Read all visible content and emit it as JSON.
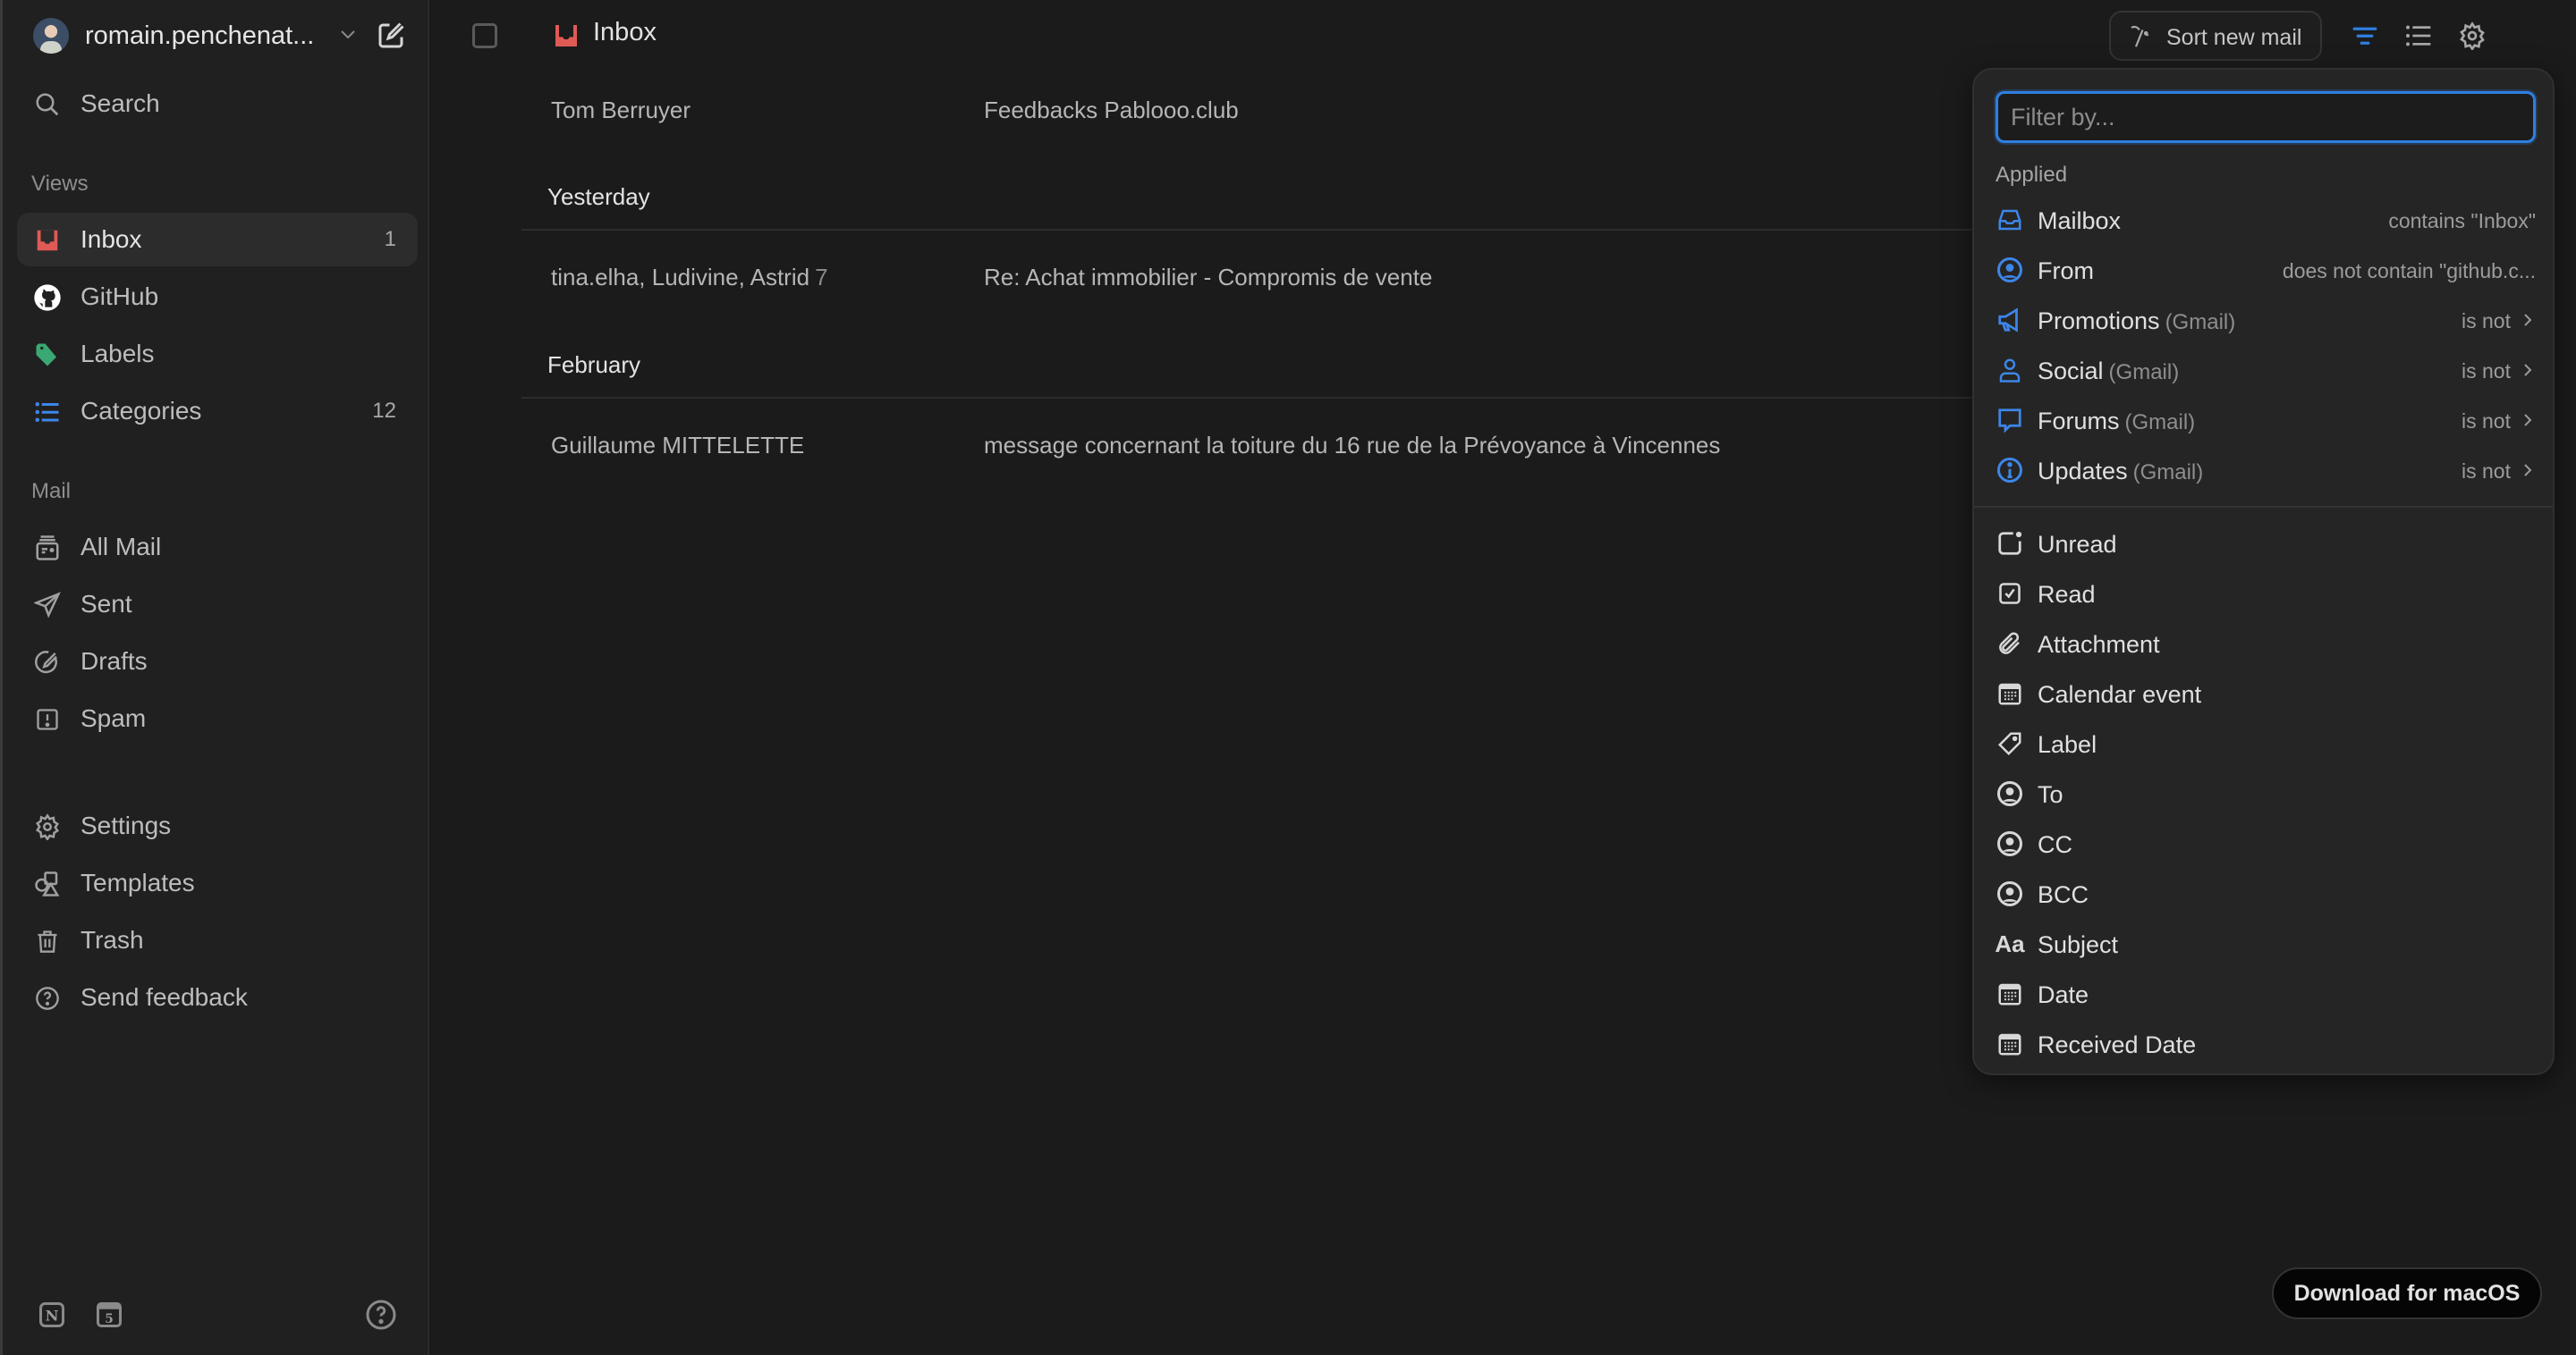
{
  "account": {
    "name": "romain.penchenat..."
  },
  "sidebar": {
    "search_label": "Search",
    "views_label": "Views",
    "views": [
      {
        "label": "Inbox",
        "count": "1",
        "icon": "inbox-icon",
        "active": true
      },
      {
        "label": "GitHub",
        "count": "",
        "icon": "github-icon"
      },
      {
        "label": "Labels",
        "count": "",
        "icon": "tag-icon"
      },
      {
        "label": "Categories",
        "count": "12",
        "icon": "list-icon"
      }
    ],
    "mail_label": "Mail",
    "mail": [
      {
        "label": "All Mail",
        "icon": "archive-icon"
      },
      {
        "label": "Sent",
        "icon": "send-icon"
      },
      {
        "label": "Drafts",
        "icon": "draft-icon"
      },
      {
        "label": "Spam",
        "icon": "spam-icon"
      }
    ],
    "other": [
      {
        "label": "Settings",
        "icon": "gear-icon"
      },
      {
        "label": "Templates",
        "icon": "shapes-icon"
      },
      {
        "label": "Trash",
        "icon": "trash-icon"
      },
      {
        "label": "Send feedback",
        "icon": "help-icon"
      }
    ],
    "bottom": {
      "notion_letter": "N",
      "calendar_day": "5"
    }
  },
  "header": {
    "title": "Inbox",
    "sort_label": "Sort new mail"
  },
  "mail_list": {
    "rows_top": [
      {
        "sender": "Tom Berruyer",
        "count": "",
        "subject": "Feedbacks Pablooo.club"
      }
    ],
    "groups": [
      {
        "label": "Yesterday",
        "rows": [
          {
            "sender": "tina.elha, Ludivine, Astrid",
            "count": "7",
            "subject": "Re: Achat immobilier - Compromis de vente"
          }
        ]
      },
      {
        "label": "February",
        "rows": [
          {
            "sender": "Guillaume MITTELETTE",
            "count": "",
            "subject": "message concernant la toiture du 16 rue de la Prévoyance à Vincennes"
          }
        ]
      }
    ]
  },
  "filter_popup": {
    "placeholder": "Filter by...",
    "value": "",
    "applied_label": "Applied",
    "applied": [
      {
        "label": "Mailbox",
        "sub": "",
        "value": "contains \"Inbox\"",
        "icon": "mailbox-icon",
        "chevron": false
      },
      {
        "label": "From",
        "sub": "",
        "value": "does not contain \"github.c...",
        "icon": "user-circle-icon",
        "chevron": false
      },
      {
        "label": "Promotions",
        "sub": "(Gmail)",
        "value": "is not",
        "icon": "megaphone-icon",
        "chevron": true
      },
      {
        "label": "Social",
        "sub": "(Gmail)",
        "value": "is not",
        "icon": "person-icon",
        "chevron": true
      },
      {
        "label": "Forums",
        "sub": "(Gmail)",
        "value": "is not",
        "icon": "chat-bubble-icon",
        "chevron": true
      },
      {
        "label": "Updates",
        "sub": "(Gmail)",
        "value": "is not",
        "icon": "info-icon",
        "chevron": true
      }
    ],
    "options": [
      {
        "label": "Unread",
        "icon": "unread-icon"
      },
      {
        "label": "Read",
        "icon": "checkbox-checked-icon"
      },
      {
        "label": "Attachment",
        "icon": "paperclip-icon"
      },
      {
        "label": "Calendar event",
        "icon": "calendar-icon"
      },
      {
        "label": "Label",
        "icon": "tag-outline-icon"
      },
      {
        "label": "To",
        "icon": "user-circle-icon"
      },
      {
        "label": "CC",
        "icon": "user-circle-icon"
      },
      {
        "label": "BCC",
        "icon": "user-circle-icon"
      },
      {
        "label": "Subject",
        "icon": "text-icon"
      },
      {
        "label": "Date",
        "icon": "calendar-icon"
      },
      {
        "label": "Received Date",
        "icon": "calendar-icon"
      }
    ]
  },
  "download_label": "Download for macOS",
  "colors": {
    "accent": "#2f7fe0",
    "inbox_red": "#e05a55",
    "label_green": "#3aa872",
    "background": "#1b1b1b",
    "sidebar": "#202020",
    "popup": "#252525"
  }
}
